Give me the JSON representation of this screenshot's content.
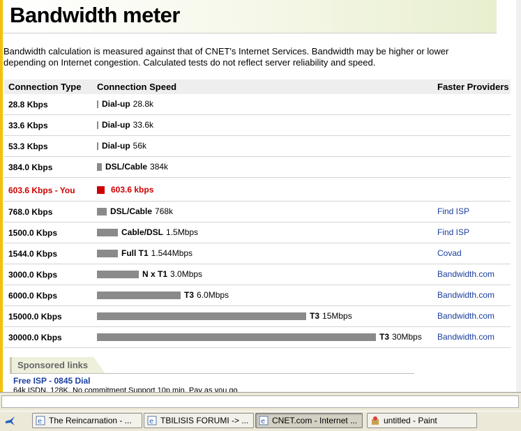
{
  "header": {
    "title": "Bandwidth meter"
  },
  "description": "Bandwidth calculation is measured against that of CNET's Internet Services. Bandwidth may be higher or lower depending on Internet congestion. Calculated tests do not reflect server reliability and speed.",
  "table": {
    "headers": {
      "type": "Connection Type",
      "speed": "Connection Speed",
      "providers": "Faster Providers"
    },
    "rows": [
      {
        "type": "28.8 Kbps",
        "bar": 0.005,
        "label": "Dial-up",
        "value": "28.8k",
        "provider": ""
      },
      {
        "type": "33.6 Kbps",
        "bar": 0.005,
        "label": "Dial-up",
        "value": "33.6k",
        "provider": ""
      },
      {
        "type": "53.3 Kbps",
        "bar": 0.005,
        "label": "Dial-up",
        "value": "56k",
        "provider": ""
      },
      {
        "type": "384.0 Kbps",
        "bar": 0.0175,
        "label": "DSL/Cable",
        "value": "384k",
        "provider": ""
      },
      {
        "type": "603.6 Kbps - You",
        "bar": 0.0275,
        "label": "",
        "value": "603.6 kbps",
        "provider": "",
        "you": true
      },
      {
        "type": "768.0 Kbps",
        "bar": 0.035,
        "label": "DSL/Cable",
        "value": "768k",
        "provider": "Find ISP"
      },
      {
        "type": "1500.0 Kbps",
        "bar": 0.075,
        "label": "Cable/DSL",
        "value": "1.5Mbps",
        "provider": "Find ISP"
      },
      {
        "type": "1544.0 Kbps",
        "bar": 0.075,
        "label": "Full T1",
        "value": "1.544Mbps",
        "provider": "Covad"
      },
      {
        "type": "3000.0 Kbps",
        "bar": 0.15,
        "label": "N x T1",
        "value": "3.0Mbps",
        "provider": "Bandwidth.com"
      },
      {
        "type": "6000.0 Kbps",
        "bar": 0.3,
        "label": "T3",
        "value": "6.0Mbps",
        "provider": "Bandwidth.com"
      },
      {
        "type": "15000.0 Kbps",
        "bar": 0.75,
        "label": "T3",
        "value": "15Mbps",
        "provider": "Bandwidth.com"
      },
      {
        "type": "30000.0 Kbps",
        "bar": 1.0,
        "label": "T3",
        "value": "30Mbps",
        "provider": "Bandwidth.com"
      }
    ]
  },
  "sponsored": {
    "heading": "Sponsored links",
    "ad_title": "Free ISP - 0845 Dial",
    "ad_text": "64k ISDN, 128K, No commitment Support 10p min, Pay as you go"
  },
  "taskbar": {
    "tasks": [
      {
        "label": "The Reincarnation - ...",
        "icon": "ie-icon"
      },
      {
        "label": "TBILISIS FORUMI -> ...",
        "icon": "ie-icon"
      },
      {
        "label": "CNET.com - Internet ...",
        "icon": "ie-icon",
        "active": true
      },
      {
        "label": "untitled - Paint",
        "icon": "paint-icon"
      }
    ]
  },
  "colors": {
    "accent_yellow": "#f2c20a",
    "you_red": "#cc0000",
    "bar_gray": "#8a8a8a",
    "link_blue": "#1a3e9e"
  }
}
